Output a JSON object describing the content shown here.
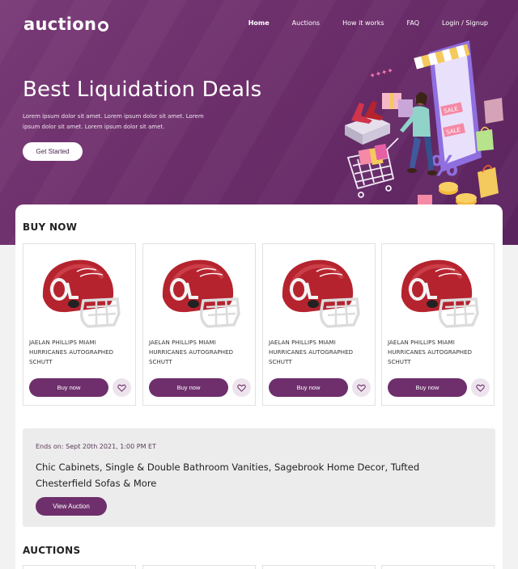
{
  "header": {
    "logo_text": "auction",
    "nav": [
      "Home",
      "Auctions",
      "How it works",
      "FAQ",
      "Login / Signup"
    ]
  },
  "hero": {
    "title": "Best Liquidation Deals",
    "subtitle": "Lorem ipsum dolor sit amet. Lorem ipsum dolor sit amet. Lorem ipsum dolor sit amet. Lorem ipsum dolor sit amet.",
    "cta_label": "Get Started",
    "illustration_sale_labels": [
      "SALE",
      "SALE"
    ]
  },
  "buy_now": {
    "heading": "BUY NOW",
    "products": [
      {
        "name": "JAELAN PHILLIPS MIAMI HURRICANES AUTOGRAPHED SCHUTT",
        "button": "Buy now"
      },
      {
        "name": "JAELAN PHILLIPS MIAMI HURRICANES AUTOGRAPHED SCHUTT",
        "button": "Buy now"
      },
      {
        "name": "JAELAN PHILLIPS MIAMI HURRICANES AUTOGRAPHED SCHUTT",
        "button": "Buy now"
      },
      {
        "name": "JAELAN PHILLIPS MIAMI HURRICANES AUTOGRAPHED SCHUTT",
        "button": "Buy now"
      }
    ]
  },
  "featured_auction": {
    "ends": "Ends on: Sept 20th 2021, 1:00 PM ET",
    "title": "Chic Cabinets, Single & Double Bathroom Vanities, Sagebrook Home Decor, Tufted Chesterfield Sofas & More",
    "button": "View Auction"
  },
  "auctions": {
    "heading": "AUCTIONS"
  },
  "colors": {
    "brand_purple": "#6e2f6c",
    "hero_bg": "#7a3b78",
    "helmet_red": "#b5232e"
  },
  "icons": [
    "logo-ring-icon",
    "heart-icon",
    "helmet-image",
    "shopping-illustration"
  ]
}
